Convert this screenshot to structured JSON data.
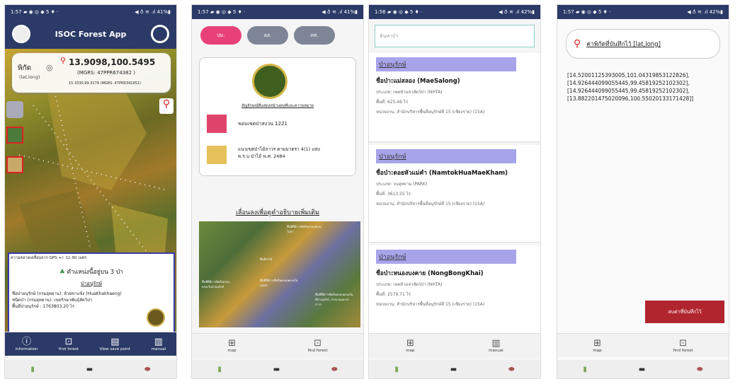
{
  "status": {
    "time": "1:57",
    "time3": "1:56",
    "icons": "▰ ◉ ◎ ◆ 5 ♦ ·",
    "right1": "◀ ♁ ≋ .ıl 41%▮",
    "right4": "◀ ♁ ≋ .ıl 42%▮"
  },
  "phone1": {
    "app_title": "ISOC Forest App",
    "coord_label": "พิกัด",
    "coord_sub": "(lat,long)",
    "coord_value": "13.9098,100.5495",
    "mgrs": "(MGRS: 47PPR674382 )",
    "mgrs_small": "15.3330,99.3179 (MGRS: 47PN5341951)",
    "gps_accuracy": "ความคลาดเคลื่อนจาก GPS +/- 11.90 เมตร",
    "card_title": "ตำแหน่งนี้อยู่บน 3 ป่า",
    "card_link": "ป่าอนุรักษ์",
    "card_line1": "ชื่อป่าอนุรักษ์ (กรมอุทยาน): ห้วยขาแข้ง (HuaKhakhaeng)",
    "card_line2": "ชนิดป่า (กรมอุทยาน): เขตรักษาพันธุ์สัตว์ป่า",
    "card_line3": "พื้นที่ป่าอนุรักษ์ : 1763803.20 ไร่",
    "tabs": [
      {
        "icon": "ⓘ",
        "label": "information"
      },
      {
        "icon": "⊡",
        "label": "find forest"
      },
      {
        "icon": "▤",
        "label": "View save point"
      },
      {
        "icon": "▥",
        "label": "manual"
      }
    ]
  },
  "phone2": {
    "pills": [
      "ปม.",
      "อส.",
      "ทส."
    ],
    "pill_colors": [
      "#e8417a",
      "#7d8597",
      "#7d8597"
    ],
    "legend_title": "สัญลักษณ์ที่แสดงหน้าแผนที่และความหมาย",
    "legend1": "ขอบเขตป่าสงวน 1221",
    "legend1_color": "#e0436c",
    "legend2": "แนวเขตป่าไม้ถาวร ตามมาตรา 4(1) แห่งพ.ร.บ.ป่าไม้ พ.ศ. 2484",
    "legend2_color": "#e6c15b",
    "scroll_text": "เลื่อนลงเพื่อดูคำอธิบายเพิ่มเติม",
    "map_labels": [
      "พื้นที่ที่มีการยึดถือครอบครองในป่า",
      "พื้นที่ป่าไม้",
      "พื้นที่ที่มีการยึดถือครอบครองในเขตป่า",
      "พื้นที่ที่มีการยึดถือครอบครองในป่าอนุรักษ์",
      "พื้นที่ที่มีการยึดถือครอบครองในที่ป่าอนุรักษ์, ป่าสงวนและป่าถาวร"
    ],
    "tabs": [
      {
        "icon": "⊞",
        "label": "map"
      },
      {
        "icon": "⊡",
        "label": "find forest"
      }
    ]
  },
  "phone3": {
    "search_placeholder": "ค้นหาป่า",
    "items": [
      {
        "head": "ป่าอนุรักษ์",
        "name": "ชื่อป่า:แม่สลอง (MaeSalong)",
        "type": "ประเภท: เขตห้ามล่าสัตว์ป่า (NHTA)",
        "area": "พื้นที่: 625.46 ไร่",
        "unit": "หน่วยงาน: สำนักบริหารพื้นที่อนุรักษ์ที่ 15 (เชียงราย) (15A)"
      },
      {
        "head": "ป่าอนุรักษ์",
        "name": "ชื่อป่า:ดอยหัวแม่คำ (NamtokHuaMaeKham)",
        "type": "ประเภท: วนอุทยาน (PARK)",
        "area": "พื้นที่: 3613.55 ไร่",
        "unit": "หน่วยงาน: สำนักบริหารพื้นที่อนุรักษ์ที่ 15 (เชียงราย) (15A)"
      },
      {
        "head": "ป่าอนุรักษ์",
        "name": "ชื่อป่า:หนองบงคาย (NongBongKhai)",
        "type": "ประเภท: เขตห้ามล่าสัตว์ป่า (NHTA)",
        "area": "พื้นที่: 2579.71 ไร่",
        "unit": "หน่วยงาน: สำนักบริหารพื้นที่อนุรักษ์ที่ 15 (เชียงราย) (15A)"
      }
    ],
    "tabs": [
      {
        "icon": "⊞",
        "label": "map"
      },
      {
        "icon": "▥",
        "label": "manual"
      }
    ]
  },
  "phone4": {
    "saved_title": "ค่าพิกัดที่บันทึกไว้ [lat,long]",
    "coords": "[14.52001125393005,101.04319853122826], [14.926444099055445,99.45819252102302], [14.926444099055445,99.45819252102302], [13.882201475020096,100.55020133171428]]",
    "save_button": "ลบค่าที่บันทึกไว้",
    "tabs": [
      {
        "icon": "⊞",
        "label": "map"
      },
      {
        "icon": "⊡",
        "label": "find forest"
      }
    ]
  },
  "nav": {
    "icons": [
      "▮",
      "▬",
      "⬬"
    ]
  }
}
